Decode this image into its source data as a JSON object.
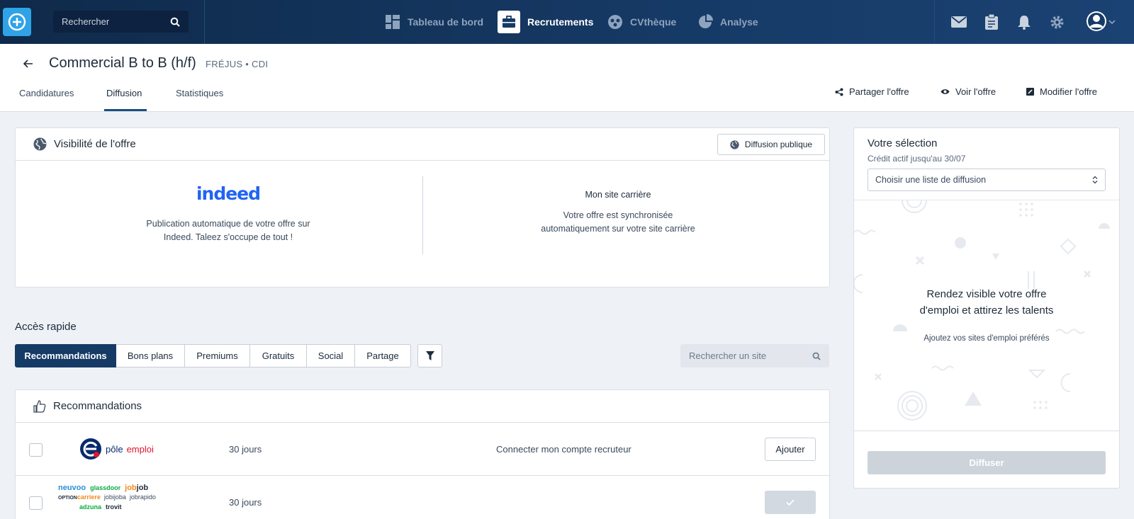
{
  "topnav": {
    "search_placeholder": "Rechercher",
    "items": [
      {
        "label": "Tableau de bord"
      },
      {
        "label": "Recrutements"
      },
      {
        "label": "CVthèque"
      },
      {
        "label": "Analyse"
      }
    ]
  },
  "header": {
    "title": "Commercial B to B (h/f)",
    "meta": "FRÉJUS • CDI",
    "tabs": [
      {
        "label": "Candidatures"
      },
      {
        "label": "Diffusion"
      },
      {
        "label": "Statistiques"
      }
    ],
    "actions": [
      {
        "label": "Partager l'offre"
      },
      {
        "label": "Voir l'offre"
      },
      {
        "label": "Modifier l'offre"
      }
    ]
  },
  "visibility": {
    "title": "Visibilité de l'offre",
    "public_button": "Diffusion publique",
    "indeed_logo": "indeed",
    "indeed_text_1": "Publication automatique de votre offre sur",
    "indeed_text_2": "Indeed. Taleez s'occupe de tout !",
    "career_title": "Mon site carrière",
    "career_text_1": "Votre offre est synchronisée",
    "career_text_2": "automatiquement sur votre site carrière"
  },
  "quick_access": {
    "title": "Accès rapide",
    "tabs": [
      {
        "label": "Recommandations"
      },
      {
        "label": "Bons plans"
      },
      {
        "label": "Premiums"
      },
      {
        "label": "Gratuits"
      },
      {
        "label": "Social"
      },
      {
        "label": "Partage"
      }
    ],
    "search_placeholder": "Rechercher un site"
  },
  "recommendations": {
    "title": "Recommandations",
    "rows": [
      {
        "logo_text_1": "pôle",
        "logo_text_2": "emploi",
        "duration": "30 jours",
        "note": "Connecter mon compte recruteur",
        "button": "Ajouter"
      },
      {
        "logos": [
          "neuvoo",
          "glassdoor",
          "jobijoba",
          "jobrapido",
          "adzuna",
          "trovit"
        ],
        "logo_optioncarriere_1": "OPTION",
        "logo_optioncarriere_2": "carriere",
        "logo_jobjob_1": "job",
        "logo_jobjob_2": "job",
        "duration": "30 jours"
      }
    ]
  },
  "selection": {
    "title": "Votre sélection",
    "credit": "Crédit actif jusqu'au 30/07",
    "select_value": "Choisir une liste de diffusion",
    "empty_title_1": "Rendez visible votre offre",
    "empty_title_2": "d'emploi et attirez les talents",
    "empty_sub": "Ajoutez vos sites d'emploi préférés",
    "button": "Diffuser"
  },
  "colors": {
    "nav_bg": "#163a66",
    "accent": "#2fa3e6",
    "active_tab": "#163a66",
    "indeed": "#2164f3"
  }
}
